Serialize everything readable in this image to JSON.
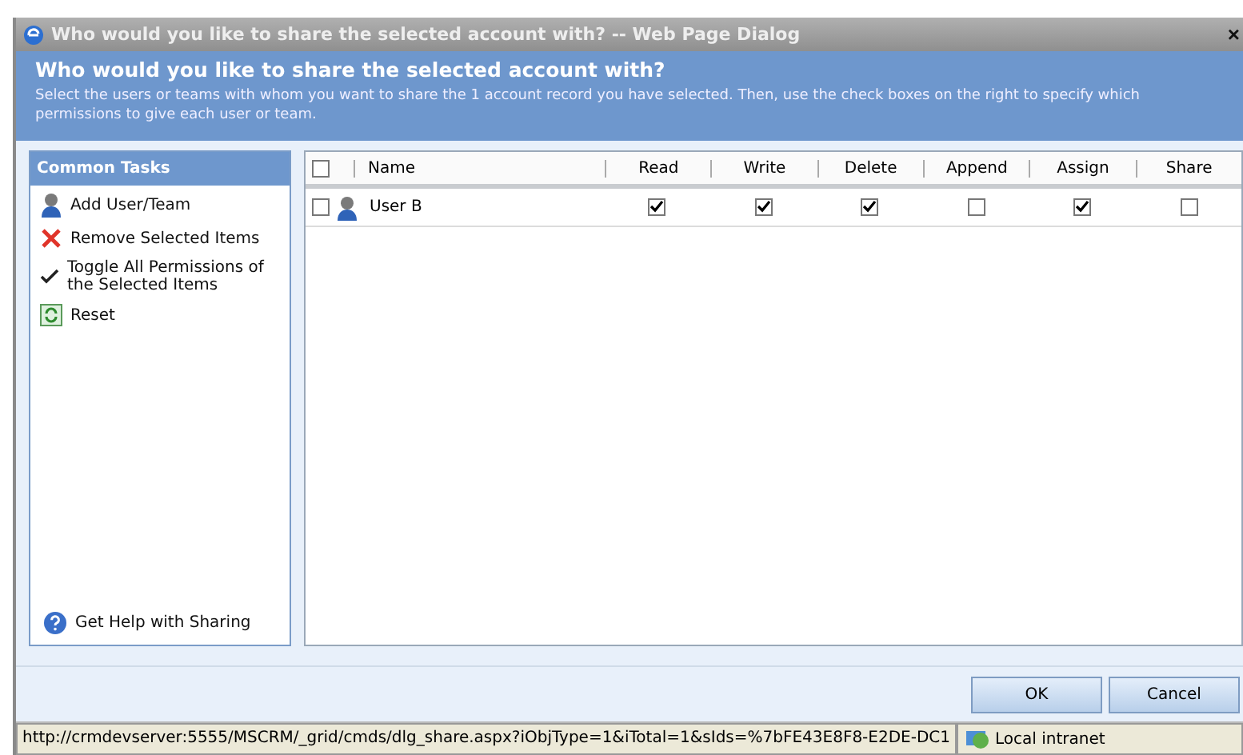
{
  "window": {
    "title": "Who would you like to share the selected account with? -- Web Page Dialog",
    "close": "×"
  },
  "header": {
    "title": "Who would you like to share the selected account with?",
    "description": "Select the users or teams with whom you want to share the 1 account record you have selected. Then, use the check boxes on the right to specify which permissions to give each user or team."
  },
  "sidebar": {
    "title": "Common Tasks",
    "items": [
      {
        "label": "Add User/Team",
        "kind": "user"
      },
      {
        "label": "Remove Selected Items",
        "kind": "remove"
      },
      {
        "label": "Toggle All Permissions of the Selected Items",
        "kind": "check"
      },
      {
        "label": "Reset",
        "kind": "reset"
      }
    ],
    "help": "Get Help with Sharing"
  },
  "table": {
    "select_all_checked": false,
    "columns": [
      "Name",
      "Read",
      "Write",
      "Delete",
      "Append",
      "Assign",
      "Share"
    ],
    "rows": [
      {
        "name": "User B",
        "selected": false,
        "permissions": [
          {
            "checked": true
          },
          {
            "checked": true
          },
          {
            "checked": true
          },
          {
            "checked": false
          },
          {
            "checked": true
          },
          {
            "checked": false
          }
        ]
      }
    ]
  },
  "buttons": [
    "OK",
    "Cancel"
  ],
  "status_bar": {
    "url": "http://crmdevserver:5555/MSCRM/_grid/cmds/dlg_share.aspx?iObjType=1&iTotal=1&sIds=%7bFE43E8F8-E2DE-DC1",
    "zone": "Local intranet"
  }
}
